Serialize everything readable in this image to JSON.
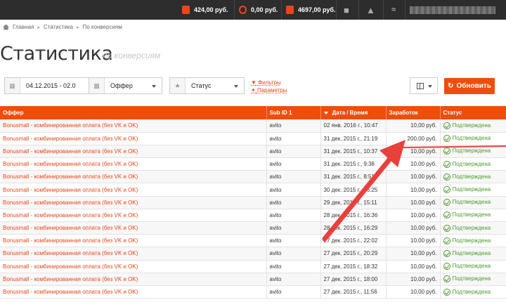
{
  "topbar": {
    "balance1": "424,00 руб.",
    "balance2": "0,00 руб.",
    "balance3": "4697,00 руб."
  },
  "breadcrumbs": [
    "Главная",
    "Статистика",
    "По конверсиям"
  ],
  "page": {
    "title": "Статистика",
    "subtitle": "по конверсиям"
  },
  "filters": {
    "date_value": "04.12.2015 - 02.0",
    "offer_label": "Оффер",
    "status_label": "Статус",
    "filters_link": "Фильтры",
    "params_link": "Параметры",
    "refresh_label": "Обновить"
  },
  "table": {
    "headers": [
      "Оффер",
      "Sub ID 1",
      "Дата / Время",
      "Заработок",
      "Статус"
    ],
    "rows": [
      {
        "offer": "Bonusmall - комбинированная оплата (без VK и OK)",
        "sub": "avito",
        "date": "02 янв. 2016 г., 10:47",
        "earn": "10,00 руб.",
        "status": "Подтверждена"
      },
      {
        "offer": "Bonusmall - комбинированная оплата (без VK и OK)",
        "sub": "avito",
        "date": "31 дек. 2015 г., 21:19",
        "earn": "200,00 руб.",
        "status": "Подтверждена"
      },
      {
        "offer": "Bonusmall - комбинированная оплата (без VK и OK)",
        "sub": "avito",
        "date": "31 дек. 2015 г., 10:37",
        "earn": "10,00 руб.",
        "status": "Подтверждена"
      },
      {
        "offer": "Bonusmall - комбинированная оплата (без VK и OK)",
        "sub": "avito",
        "date": "31 дек. 2015 г., 9:38",
        "earn": "10,00 руб.",
        "status": "Подтверждена"
      },
      {
        "offer": "Bonusmall - комбинированная оплата (без VK и OK)",
        "sub": "avito",
        "date": "31 дек. 2015 г., 8:51",
        "earn": "10,00 руб.",
        "status": "Подтверждена"
      },
      {
        "offer": "Bonusmall - комбинированная оплата (без VK и OK)",
        "sub": "avito",
        "date": "30 дек. 2015 г., 16:25",
        "earn": "10,00 руб.",
        "status": "Подтверждена"
      },
      {
        "offer": "Bonusmall - комбинированная оплата (без VK и OK)",
        "sub": "avito",
        "date": "29 дек. 2015 г., 15:11",
        "earn": "10,00 руб.",
        "status": "Подтверждена"
      },
      {
        "offer": "Bonusmall - комбинированная оплата (без VK и OK)",
        "sub": "avito",
        "date": "28 дек. 2015 г., 16:36",
        "earn": "10,00 руб.",
        "status": "Подтверждена"
      },
      {
        "offer": "Bonusmall - комбинированная оплата (без VK и OK)",
        "sub": "avito",
        "date": "28 дек. 2015 г., 16:29",
        "earn": "10,00 руб.",
        "status": "Подтверждена"
      },
      {
        "offer": "Bonusmall - комбинированная оплата (без VK и OK)",
        "sub": "avito",
        "date": "27 дек. 2015 г., 22:02",
        "earn": "10,00 руб.",
        "status": "Подтверждена"
      },
      {
        "offer": "Bonusmall - комбинированная оплата (без VK и OK)",
        "sub": "avito",
        "date": "27 дек. 2015 г., 20:29",
        "earn": "10,00 руб.",
        "status": "Подтверждена"
      },
      {
        "offer": "Bonusmall - комбинированная оплата (без VK и OK)",
        "sub": "avito",
        "date": "27 дек. 2015 г., 18:32",
        "earn": "10,00 руб.",
        "status": "Подтверждена"
      },
      {
        "offer": "Bonusmall - комбинированная оплата (без VK и OK)",
        "sub": "avito",
        "date": "27 дек. 2015 г., 18:00",
        "earn": "10,00 руб.",
        "status": "Подтверждена"
      },
      {
        "offer": "Bonusmall - комбинированная оплата (без VK и OK)",
        "sub": "avito",
        "date": "27 дек. 2015 г., 11:56",
        "earn": "10,00 руб.",
        "status": "Подтверждена"
      }
    ]
  },
  "colors": {
    "accent": "#ef4d0c",
    "topbar": "#2d2d2d",
    "success": "#4a9a2a",
    "annotation": "#e8403a"
  },
  "icons": [
    "wallet-icon",
    "clock-icon",
    "lock-icon",
    "chat-icon",
    "warning-icon",
    "rss-icon",
    "home-icon",
    "calendar-icon",
    "briefcase-icon",
    "star-icon",
    "filter-icon",
    "wrench-icon",
    "columns-icon",
    "refresh-icon",
    "check-circle-icon"
  ]
}
